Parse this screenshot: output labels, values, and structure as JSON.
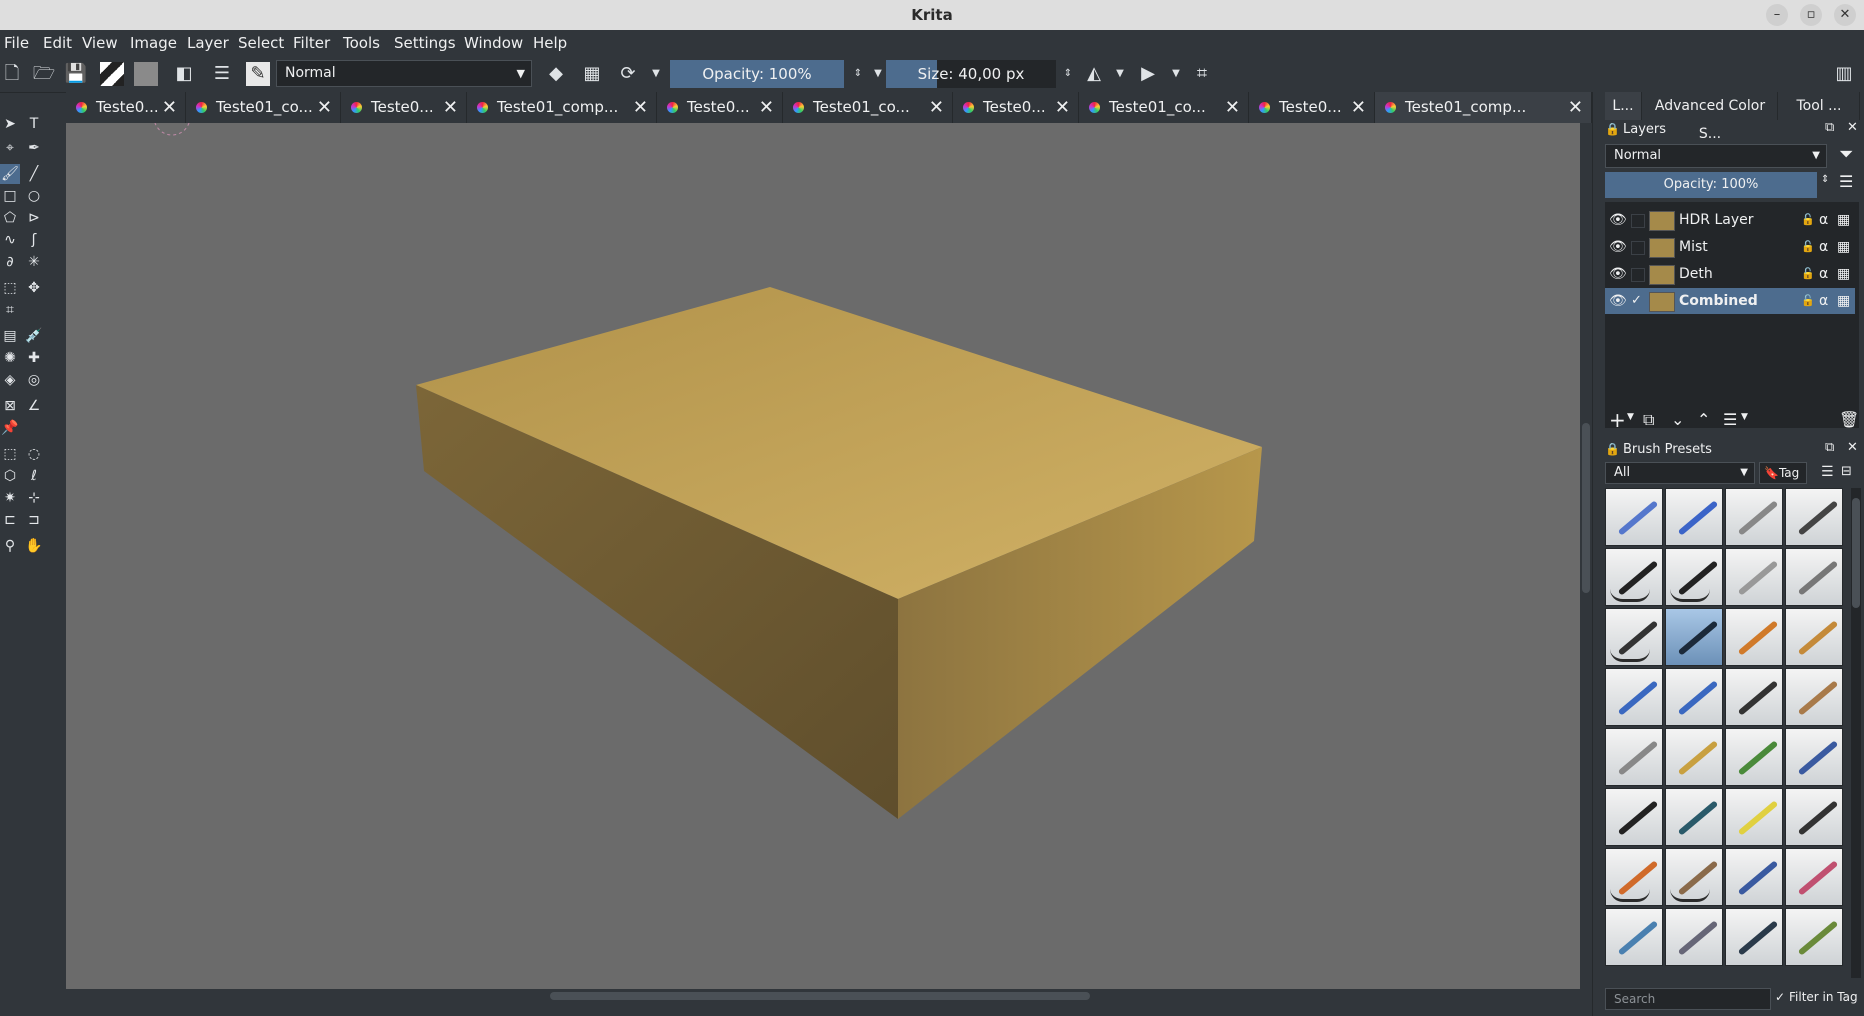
{
  "window": {
    "title": "Krita"
  },
  "menubar": [
    "File",
    "Edit",
    "View",
    "Image",
    "Layer",
    "Select",
    "Filter",
    "Tools",
    "Settings",
    "Window",
    "Help"
  ],
  "toolbar": {
    "blend_mode": "Normal",
    "opacity_label": "Opacity: 100%",
    "size_label": "Size: 40,00 px"
  },
  "tabs": [
    {
      "label": "Teste0...",
      "active": false
    },
    {
      "label": "Teste01_co...",
      "active": false
    },
    {
      "label": "Teste0...",
      "active": false
    },
    {
      "label": "Teste01_comp...",
      "active": false
    },
    {
      "label": "Teste0...",
      "active": false
    },
    {
      "label": "Teste01_co...",
      "active": false
    },
    {
      "label": "Teste0...",
      "active": false
    },
    {
      "label": "Teste01_co...",
      "active": false
    },
    {
      "label": "Teste0...",
      "active": false
    },
    {
      "label": "Teste01_comp...",
      "active": true
    }
  ],
  "docker": {
    "tabs": [
      "L...",
      "Advanced Color S...",
      "Tool ..."
    ],
    "layers": {
      "title": "Layers",
      "blend_mode": "Normal",
      "opacity_label": "Opacity:  100%",
      "items": [
        {
          "name": "HDR Layer",
          "selected": false,
          "checked": false
        },
        {
          "name": "Mist",
          "selected": false,
          "checked": false
        },
        {
          "name": "Deth",
          "selected": false,
          "checked": false
        },
        {
          "name": "Combined",
          "selected": true,
          "checked": true
        }
      ]
    },
    "brush_presets": {
      "title": "Brush Presets",
      "filter": "All",
      "tag_label": "Tag",
      "search_placeholder": "Search",
      "filter_in_tag_label": "Filter in Tag"
    }
  },
  "colors": {
    "canvas_bg": "#6b6b6b",
    "box_top": "#c9a85a",
    "box_front": "#a8873f",
    "box_side": "#6e5a32",
    "accent": "#4d6c8e"
  }
}
